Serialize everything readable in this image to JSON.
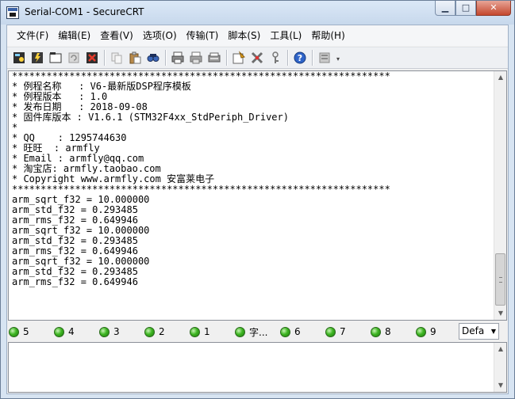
{
  "window": {
    "title": "Serial-COM1 - SecureCRT",
    "minimize_glyph": "▁",
    "maximize_glyph": "□",
    "close_glyph": "✕"
  },
  "menu": [
    "文件(F)",
    "编辑(E)",
    "查看(V)",
    "选项(O)",
    "传输(T)",
    "脚本(S)",
    "工具(L)",
    "帮助(H)"
  ],
  "toolbar": {
    "icons": [
      "connect-icon",
      "quick-connect-icon",
      "connect-tab-icon",
      "reconnect-icon",
      "disconnect-icon",
      "copy-icon",
      "paste-icon",
      "find-icon",
      "print-icon",
      "print-selection-icon",
      "print-setup-icon",
      "session-options-icon",
      "map-keys-icon",
      "sftp-key-icon",
      "help-icon",
      "keymap-icon"
    ],
    "more_glyph": "▾"
  },
  "terminal": {
    "lines": [
      "******************************************************************",
      "* 例程名称   : V6-最新版DSP程序模板",
      "* 例程版本   : 1.0",
      "* 发布日期   : 2018-09-08",
      "* 固件库版本 : V1.6.1 (STM32F4xx_StdPeriph_Driver)",
      "*",
      "* QQ    : 1295744630",
      "* 旺旺  : armfly",
      "* Email : armfly@qq.com",
      "* 淘宝店: armfly.taobao.com",
      "* Copyright www.armfly.com 安富莱电子",
      "******************************************************************",
      "arm_sqrt_f32 = 10.000000",
      "arm_std_f32 = 0.293485",
      "arm_rms_f32 = 0.649946",
      "arm_sqrt_f32 = 10.000000",
      "arm_std_f32 = 0.293485",
      "arm_rms_f32 = 0.649946",
      "arm_sqrt_f32 = 10.000000",
      "arm_std_f32 = 0.293485",
      "arm_rms_f32 = 0.649946"
    ]
  },
  "buttonbar": {
    "buttons": [
      "5",
      "4",
      "3",
      "2",
      "1",
      "字...",
      "6",
      "7",
      "8",
      "9"
    ],
    "led_color": "#3fb623",
    "combo_value": "Defa",
    "combo_arrow": "▼"
  },
  "scroll": {
    "up": "▲",
    "down": "▼"
  }
}
